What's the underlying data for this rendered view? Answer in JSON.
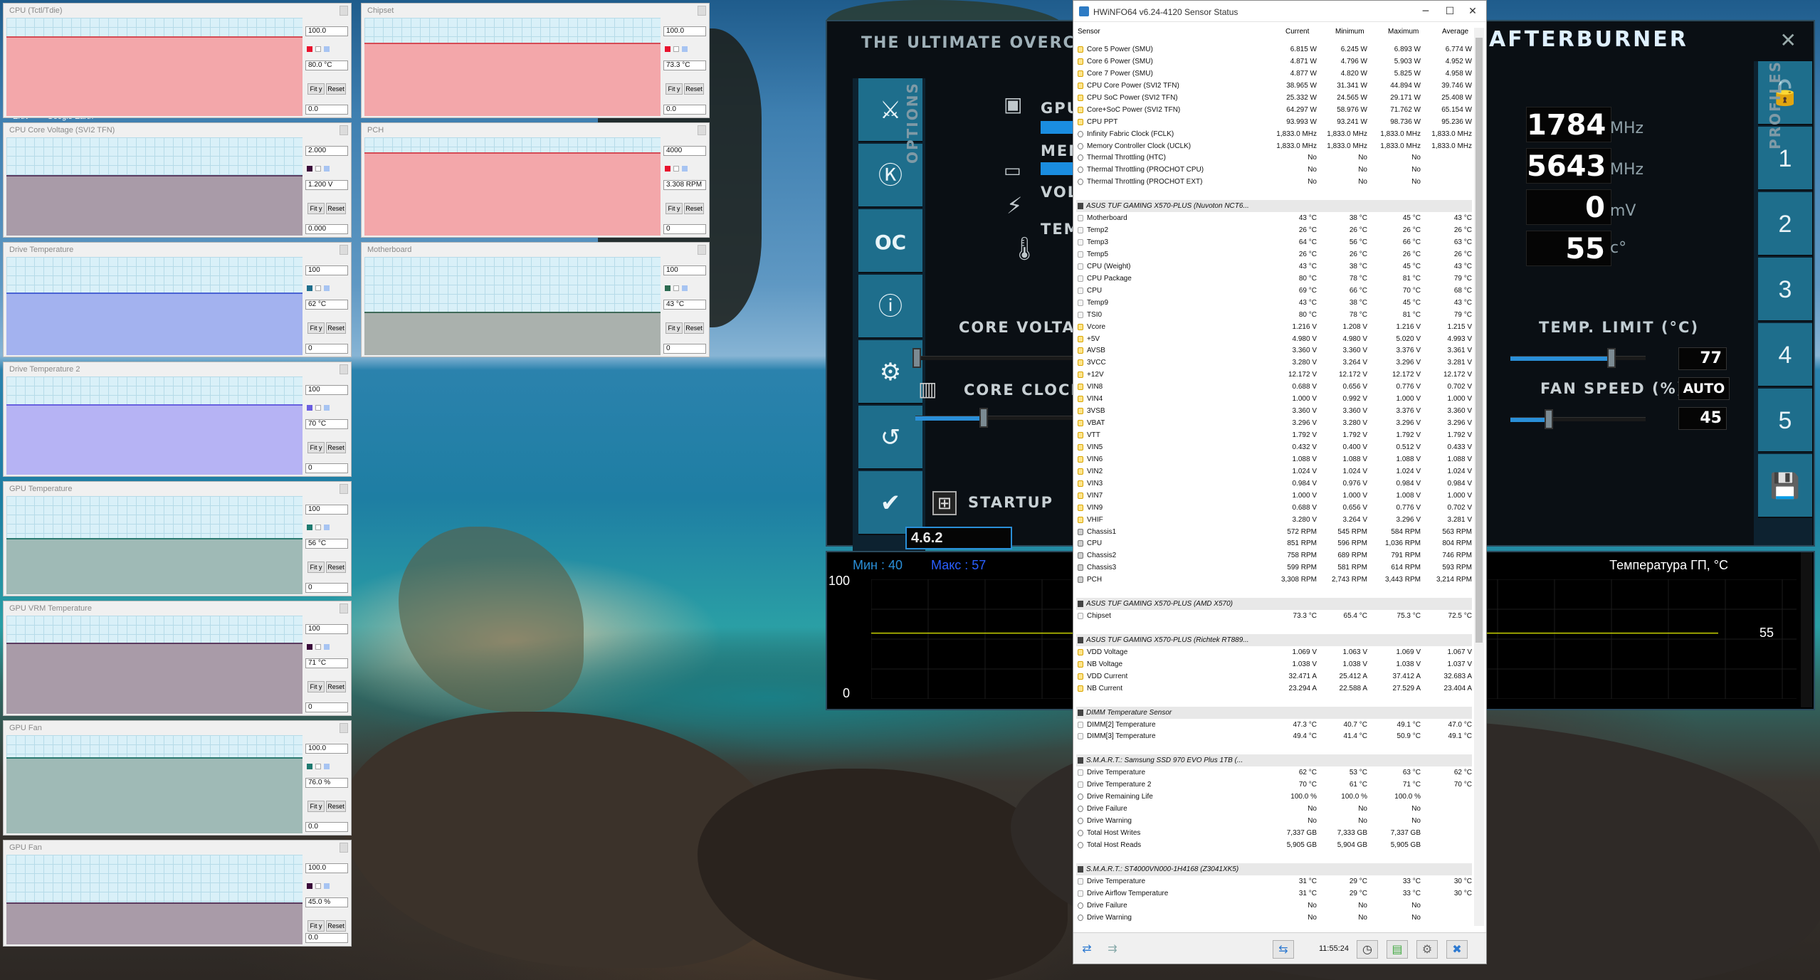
{
  "graphs": [
    {
      "title": "CPU (Tctl/Tdie)",
      "max": "100.0",
      "current": "80.0 °C",
      "min": "0.0",
      "fill": "#f3a7aa",
      "line": "#d54b55",
      "level": 0.8,
      "swatch": "#e8112d"
    },
    {
      "title": "Chipset",
      "max": "100.0",
      "current": "73.3 °C",
      "min": "0.0",
      "fill": "#f3a7aa",
      "line": "#d54b55",
      "level": 0.73,
      "swatch": "#e8112d"
    },
    {
      "title": "CPU Core Voltage (SVI2 TFN)",
      "max": "2.000",
      "current": "1.200 V",
      "min": "0.000",
      "fill": "#a99ba8",
      "line": "#5c3c60",
      "level": 0.6,
      "swatch": "#3a0a3a"
    },
    {
      "title": "PCH",
      "max": "4000",
      "current": "3.308 RPM",
      "min": "0",
      "fill": "#f3a7aa",
      "line": "#d54b55",
      "level": 0.83,
      "swatch": "#e8112d"
    },
    {
      "title": "Drive Temperature",
      "max": "100",
      "current": "62 °C",
      "min": "0",
      "fill": "#a3b2ef",
      "line": "#4a63d4",
      "level": 0.62,
      "swatch": "#1d6e8c"
    },
    {
      "title": "Motherboard",
      "max": "100",
      "current": "43 °C",
      "min": "0",
      "fill": "#aab1ad",
      "line": "#3f6a58",
      "level": 0.43,
      "swatch": "#2c6a50"
    },
    {
      "title": "Drive Temperature 2",
      "max": "100",
      "current": "70 °C",
      "min": "0",
      "fill": "#b6b3f4",
      "line": "#6860e0",
      "level": 0.7,
      "swatch": "#6a5ee0"
    },
    {
      "title": "GPU Temperature",
      "max": "100",
      "current": "56 °C",
      "min": "0",
      "fill": "#9fbab6",
      "line": "#2c7a70",
      "level": 0.56,
      "swatch": "#1d7a70"
    },
    {
      "title": "GPU VRM Temperature",
      "max": "100",
      "current": "71 °C",
      "min": "0",
      "fill": "#a99ba8",
      "line": "#5c3c60",
      "level": 0.71,
      "swatch": "#3a0a3a"
    },
    {
      "title": "GPU Fan",
      "max": "100.0",
      "current": "76.0 %",
      "min": "0.0",
      "fill": "#9fbab6",
      "line": "#2c7a70",
      "level": 0.76,
      "swatch": "#1d7a70"
    },
    {
      "title": "GPU Fan",
      "max": "100.0",
      "current": "45.0 %",
      "min": "0.0",
      "fill": "#a99ba8",
      "line": "#5c3c60",
      "level": 0.45,
      "swatch": "#3a0a3a"
    }
  ],
  "buttons": {
    "fit": "Fit y",
    "reset": "Reset"
  },
  "desktop_text": {
    "a": "Ertrt",
    "b": "Google Earth"
  },
  "hwinfo": {
    "title": "HWiNFO64 v6.24-4120 Sensor Status",
    "headers": {
      "sensor": "Sensor",
      "current": "Current",
      "minimum": "Minimum",
      "maximum": "Maximum",
      "average": "Average"
    },
    "time": "11:55:24",
    "rows": [
      {
        "k": "v",
        "l": "Core 5 Power (SMU)",
        "c": "6.815 W",
        "mi": "6.245 W",
        "ma": "6.893 W",
        "a": "6.774 W"
      },
      {
        "k": "v",
        "l": "Core 6 Power (SMU)",
        "c": "4.871 W",
        "mi": "4.796 W",
        "ma": "5.903 W",
        "a": "4.952 W"
      },
      {
        "k": "v",
        "l": "Core 7 Power (SMU)",
        "c": "4.877 W",
        "mi": "4.820 W",
        "ma": "5.825 W",
        "a": "4.958 W"
      },
      {
        "k": "v",
        "l": "CPU Core Power (SVI2 TFN)",
        "c": "38.965 W",
        "mi": "31.341 W",
        "ma": "44.894 W",
        "a": "39.746 W"
      },
      {
        "k": "v",
        "l": "CPU SoC Power (SVI2 TFN)",
        "c": "25.332 W",
        "mi": "24.565 W",
        "ma": "29.171 W",
        "a": "25.408 W"
      },
      {
        "k": "v",
        "l": "Core+SoC Power (SVI2 TFN)",
        "c": "64.297 W",
        "mi": "58.976 W",
        "ma": "71.762 W",
        "a": "65.154 W"
      },
      {
        "k": "v",
        "l": "CPU PPT",
        "c": "93.993 W",
        "mi": "93.241 W",
        "ma": "98.736 W",
        "a": "95.236 W"
      },
      {
        "k": "o",
        "l": "Infinity Fabric Clock (FCLK)",
        "c": "1,833.0 MHz",
        "mi": "1,833.0 MHz",
        "ma": "1,833.0 MHz",
        "a": "1,833.0 MHz"
      },
      {
        "k": "o",
        "l": "Memory Controller Clock (UCLK)",
        "c": "1,833.0 MHz",
        "mi": "1,833.0 MHz",
        "ma": "1,833.0 MHz",
        "a": "1,833.0 MHz"
      },
      {
        "k": "o",
        "l": "Thermal Throttling (HTC)",
        "c": "No",
        "mi": "No",
        "ma": "No",
        "a": ""
      },
      {
        "k": "o",
        "l": "Thermal Throttling (PROCHOT CPU)",
        "c": "No",
        "mi": "No",
        "ma": "No",
        "a": ""
      },
      {
        "k": "o",
        "l": "Thermal Throttling (PROCHOT EXT)",
        "c": "No",
        "mi": "No",
        "ma": "No",
        "a": ""
      },
      {
        "k": "gap"
      },
      {
        "k": "g",
        "l": "ASUS TUF GAMING X570-PLUS (Nuvoton NCT6..."
      },
      {
        "k": "t",
        "l": "Motherboard",
        "c": "43 °C",
        "mi": "38 °C",
        "ma": "45 °C",
        "a": "43 °C"
      },
      {
        "k": "t",
        "l": "Temp2",
        "c": "26 °C",
        "mi": "26 °C",
        "ma": "26 °C",
        "a": "26 °C"
      },
      {
        "k": "t",
        "l": "Temp3",
        "c": "64 °C",
        "mi": "56 °C",
        "ma": "66 °C",
        "a": "63 °C"
      },
      {
        "k": "t",
        "l": "Temp5",
        "c": "26 °C",
        "mi": "26 °C",
        "ma": "26 °C",
        "a": "26 °C"
      },
      {
        "k": "t",
        "l": "CPU (Weight)",
        "c": "43 °C",
        "mi": "38 °C",
        "ma": "45 °C",
        "a": "43 °C"
      },
      {
        "k": "t",
        "l": "CPU Package",
        "c": "80 °C",
        "mi": "78 °C",
        "ma": "81 °C",
        "a": "79 °C"
      },
      {
        "k": "t",
        "l": "CPU",
        "c": "69 °C",
        "mi": "66 °C",
        "ma": "70 °C",
        "a": "68 °C"
      },
      {
        "k": "t",
        "l": "Temp9",
        "c": "43 °C",
        "mi": "38 °C",
        "ma": "45 °C",
        "a": "43 °C"
      },
      {
        "k": "t",
        "l": "TSI0",
        "c": "80 °C",
        "mi": "78 °C",
        "ma": "81 °C",
        "a": "79 °C"
      },
      {
        "k": "v",
        "l": "Vcore",
        "c": "1.216 V",
        "mi": "1.208 V",
        "ma": "1.216 V",
        "a": "1.215 V"
      },
      {
        "k": "v",
        "l": "+5V",
        "c": "4.980 V",
        "mi": "4.980 V",
        "ma": "5.020 V",
        "a": "4.993 V"
      },
      {
        "k": "v",
        "l": "AVSB",
        "c": "3.360 V",
        "mi": "3.360 V",
        "ma": "3.376 V",
        "a": "3.361 V"
      },
      {
        "k": "v",
        "l": "3VCC",
        "c": "3.280 V",
        "mi": "3.264 V",
        "ma": "3.296 V",
        "a": "3.281 V"
      },
      {
        "k": "v",
        "l": "+12V",
        "c": "12.172 V",
        "mi": "12.172 V",
        "ma": "12.172 V",
        "a": "12.172 V"
      },
      {
        "k": "v",
        "l": "VIN8",
        "c": "0.688 V",
        "mi": "0.656 V",
        "ma": "0.776 V",
        "a": "0.702 V"
      },
      {
        "k": "v",
        "l": "VIN4",
        "c": "1.000 V",
        "mi": "0.992 V",
        "ma": "1.000 V",
        "a": "1.000 V"
      },
      {
        "k": "v",
        "l": "3VSB",
        "c": "3.360 V",
        "mi": "3.360 V",
        "ma": "3.376 V",
        "a": "3.360 V"
      },
      {
        "k": "v",
        "l": "VBAT",
        "c": "3.296 V",
        "mi": "3.280 V",
        "ma": "3.296 V",
        "a": "3.296 V"
      },
      {
        "k": "v",
        "l": "VTT",
        "c": "1.792 V",
        "mi": "1.792 V",
        "ma": "1.792 V",
        "a": "1.792 V"
      },
      {
        "k": "v",
        "l": "VIN5",
        "c": "0.432 V",
        "mi": "0.400 V",
        "ma": "0.512 V",
        "a": "0.433 V"
      },
      {
        "k": "v",
        "l": "VIN6",
        "c": "1.088 V",
        "mi": "1.088 V",
        "ma": "1.088 V",
        "a": "1.088 V"
      },
      {
        "k": "v",
        "l": "VIN2",
        "c": "1.024 V",
        "mi": "1.024 V",
        "ma": "1.024 V",
        "a": "1.024 V"
      },
      {
        "k": "v",
        "l": "VIN3",
        "c": "0.984 V",
        "mi": "0.976 V",
        "ma": "0.984 V",
        "a": "0.984 V"
      },
      {
        "k": "v",
        "l": "VIN7",
        "c": "1.000 V",
        "mi": "1.000 V",
        "ma": "1.008 V",
        "a": "1.000 V"
      },
      {
        "k": "v",
        "l": "VIN9",
        "c": "0.688 V",
        "mi": "0.656 V",
        "ma": "0.776 V",
        "a": "0.702 V"
      },
      {
        "k": "v",
        "l": "VHIF",
        "c": "3.280 V",
        "mi": "3.264 V",
        "ma": "3.296 V",
        "a": "3.281 V"
      },
      {
        "k": "f",
        "l": "Chassis1",
        "c": "572 RPM",
        "mi": "545 RPM",
        "ma": "584 RPM",
        "a": "563 RPM"
      },
      {
        "k": "f",
        "l": "CPU",
        "c": "851 RPM",
        "mi": "596 RPM",
        "ma": "1,036 RPM",
        "a": "804 RPM"
      },
      {
        "k": "f",
        "l": "Chassis2",
        "c": "758 RPM",
        "mi": "689 RPM",
        "ma": "791 RPM",
        "a": "746 RPM"
      },
      {
        "k": "f",
        "l": "Chassis3",
        "c": "599 RPM",
        "mi": "581 RPM",
        "ma": "614 RPM",
        "a": "593 RPM"
      },
      {
        "k": "f",
        "l": "PCH",
        "c": "3,308 RPM",
        "mi": "2,743 RPM",
        "ma": "3,443 RPM",
        "a": "3,214 RPM"
      },
      {
        "k": "gap"
      },
      {
        "k": "g",
        "l": "ASUS TUF GAMING X570-PLUS (AMD X570)"
      },
      {
        "k": "t",
        "l": "Chipset",
        "c": "73.3 °C",
        "mi": "65.4 °C",
        "ma": "75.3 °C",
        "a": "72.5 °C"
      },
      {
        "k": "gap"
      },
      {
        "k": "g",
        "l": "ASUS TUF GAMING X570-PLUS (Richtek RT889..."
      },
      {
        "k": "v",
        "l": "VDD Voltage",
        "c": "1.069 V",
        "mi": "1.063 V",
        "ma": "1.069 V",
        "a": "1.067 V"
      },
      {
        "k": "v",
        "l": "NB Voltage",
        "c": "1.038 V",
        "mi": "1.038 V",
        "ma": "1.038 V",
        "a": "1.037 V"
      },
      {
        "k": "v",
        "l": "VDD Current",
        "c": "32.471 A",
        "mi": "25.412 A",
        "ma": "37.412 A",
        "a": "32.683 A"
      },
      {
        "k": "v",
        "l": "NB Current",
        "c": "23.294 A",
        "mi": "22.588 A",
        "ma": "27.529 A",
        "a": "23.404 A"
      },
      {
        "k": "gap"
      },
      {
        "k": "g",
        "l": "DIMM Temperature Sensor"
      },
      {
        "k": "t",
        "l": "DIMM[2] Temperature",
        "c": "47.3 °C",
        "mi": "40.7 °C",
        "ma": "49.1 °C",
        "a": "47.0 °C"
      },
      {
        "k": "t",
        "l": "DIMM[3] Temperature",
        "c": "49.4 °C",
        "mi": "41.4 °C",
        "ma": "50.9 °C",
        "a": "49.1 °C"
      },
      {
        "k": "gap"
      },
      {
        "k": "g",
        "l": "S.M.A.R.T.: Samsung SSD 970 EVO Plus 1TB (..."
      },
      {
        "k": "t",
        "l": "Drive Temperature",
        "c": "62 °C",
        "mi": "53 °C",
        "ma": "63 °C",
        "a": "62 °C"
      },
      {
        "k": "t",
        "l": "Drive Temperature 2",
        "c": "70 °C",
        "mi": "61 °C",
        "ma": "71 °C",
        "a": "70 °C"
      },
      {
        "k": "o",
        "l": "Drive Remaining Life",
        "c": "100.0 %",
        "mi": "100.0 %",
        "ma": "100.0 %",
        "a": ""
      },
      {
        "k": "o",
        "l": "Drive Failure",
        "c": "No",
        "mi": "No",
        "ma": "No",
        "a": ""
      },
      {
        "k": "o",
        "l": "Drive Warning",
        "c": "No",
        "mi": "No",
        "ma": "No",
        "a": ""
      },
      {
        "k": "o",
        "l": "Total Host Writes",
        "c": "7,337 GB",
        "mi": "7,333 GB",
        "ma": "7,337 GB",
        "a": ""
      },
      {
        "k": "o",
        "l": "Total Host Reads",
        "c": "5,905 GB",
        "mi": "5,904 GB",
        "ma": "5,905 GB",
        "a": ""
      },
      {
        "k": "gap"
      },
      {
        "k": "g",
        "l": "S.M.A.R.T.: ST4000VN000-1H4168 (Z3041XK5)"
      },
      {
        "k": "t",
        "l": "Drive Temperature",
        "c": "31 °C",
        "mi": "29 °C",
        "ma": "33 °C",
        "a": "30 °C"
      },
      {
        "k": "t",
        "l": "Drive Airflow Temperature",
        "c": "31 °C",
        "mi": "29 °C",
        "ma": "33 °C",
        "a": "30 °C"
      },
      {
        "k": "o",
        "l": "Drive Failure",
        "c": "No",
        "mi": "No",
        "ma": "No",
        "a": ""
      },
      {
        "k": "o",
        "l": "Drive Warning",
        "c": "No",
        "mi": "No",
        "ma": "No",
        "a": ""
      }
    ]
  },
  "afterburner": {
    "banner": "THE ULTIMATE OVERCLO",
    "logo": "AFTERBURNER",
    "version": "4.6.2",
    "gpu_label": "GPU",
    "mem_label": "MEM",
    "volt_label": "VOL",
    "temp_label": "TEM",
    "options": "OPTIONS",
    "profiles": "PROFILES",
    "core_voltage": "CORE VOLTAGE",
    "core_clock": "CORE CLOCK",
    "temp_limit": "TEMP. LIMIT (°C)",
    "fan_speed": "FAN SPEED (%)",
    "auto": "AUTO",
    "startup": "STARTUP",
    "gpu_clock": "1784",
    "gpu_clock_unit": "MHz",
    "mem_clock": "5643",
    "mem_clock_unit": "MHz",
    "voltage": "0",
    "voltage_unit": "mV",
    "temp": "55",
    "temp_unit": "c°",
    "temp_limit_val": "77",
    "fan_val": "45",
    "profiles_list": [
      "1",
      "2",
      "3",
      "4",
      "5"
    ],
    "graph": {
      "min_label": "Мин : 40",
      "max_label": "Макс : 57",
      "title": "Температура ГП, °C",
      "ymax": "100",
      "ymin": "0",
      "current": "55",
      "value": 55
    }
  }
}
